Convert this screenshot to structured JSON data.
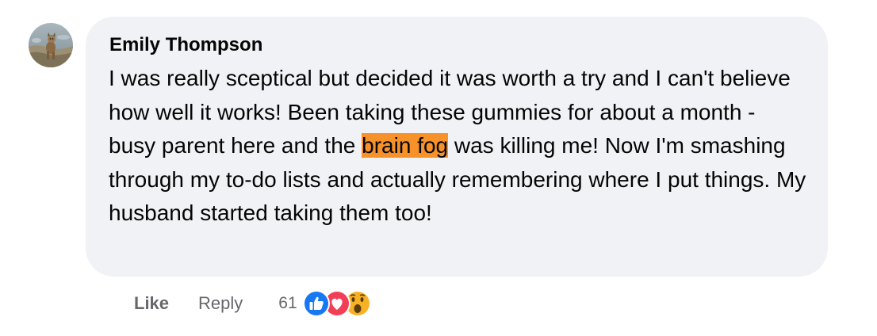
{
  "comment": {
    "author": "Emily Thompson",
    "text_before": "I was really sceptical but decided it was worth a try and I can't believe how well it works! Been taking these gummies for about a month - busy parent here and the ",
    "highlighted_text": "brain fog",
    "text_after": " was killing me! Now I'm smashing through my to-do lists and actually remembering where I put things. My husband started taking them too!"
  },
  "actions": {
    "like_label": "Like",
    "reply_label": "Reply",
    "reaction_count": "61"
  },
  "reactions": [
    {
      "icon": "like-reaction-icon",
      "color": "#1877f2"
    },
    {
      "icon": "love-reaction-icon",
      "color": "#f33e58"
    },
    {
      "icon": "wow-reaction-icon",
      "color": "#f7b125"
    }
  ],
  "colors": {
    "bubble": "#f0f2f5",
    "highlight": "#f7912a",
    "secondary_text": "#65676b"
  }
}
